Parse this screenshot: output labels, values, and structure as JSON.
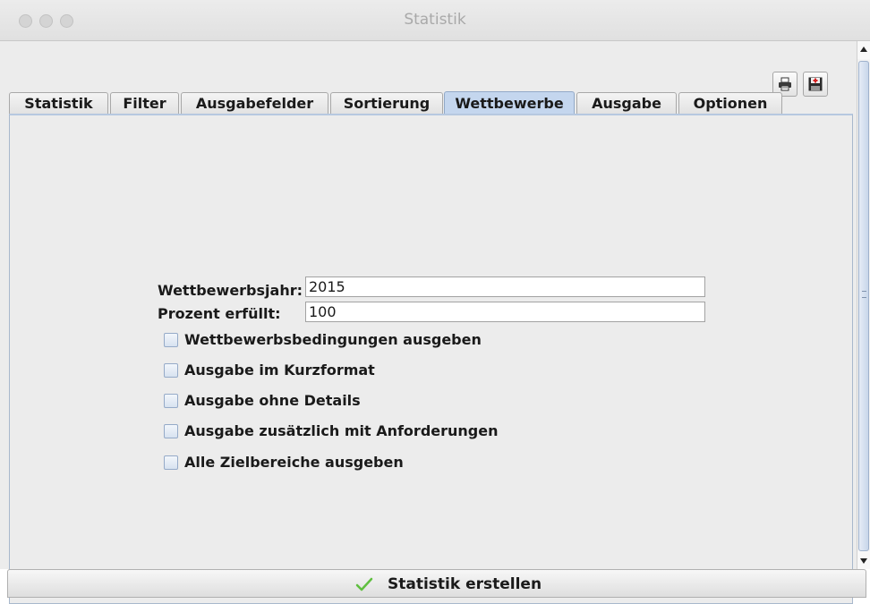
{
  "window": {
    "title": "Statistik"
  },
  "toolbar": {
    "print_icon": "printer-icon",
    "save_icon": "save-disk-icon"
  },
  "tabs": [
    {
      "label": "Statistik",
      "active": false
    },
    {
      "label": "Filter",
      "active": false
    },
    {
      "label": "Ausgabefelder",
      "active": false
    },
    {
      "label": "Sortierung",
      "active": false
    },
    {
      "label": "Wettbewerbe",
      "active": true
    },
    {
      "label": "Ausgabe",
      "active": false
    },
    {
      "label": "Optionen",
      "active": false
    }
  ],
  "form": {
    "year_label": "Wettbewerbsjahr:",
    "year_value": "2015",
    "percent_label": "Prozent erfüllt:",
    "percent_value": "100"
  },
  "checkboxes": [
    {
      "label": "Wettbewerbsbedingungen ausgeben",
      "checked": false
    },
    {
      "label": "Ausgabe im Kurzformat",
      "checked": false
    },
    {
      "label": "Ausgabe ohne Details",
      "checked": false
    },
    {
      "label": "Ausgabe zusätzlich mit Anforderungen",
      "checked": false
    },
    {
      "label": "Alle Zielbereiche ausgeben",
      "checked": false
    }
  ],
  "actions": {
    "create_label": "Statistik erstellen"
  },
  "colors": {
    "active_tab": "#c4d6ee",
    "check_icon": "#5fbf3f"
  }
}
